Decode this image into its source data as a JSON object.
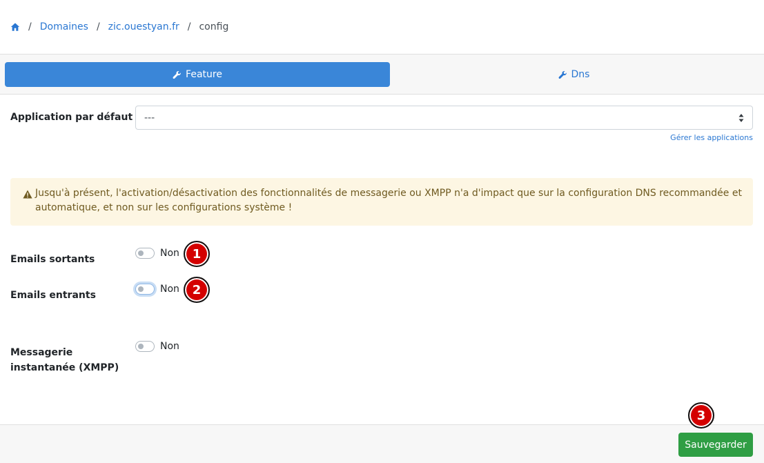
{
  "breadcrumb": {
    "home_icon": "home-icon",
    "items": [
      "Domaines",
      "zic.ouestyan.fr",
      "config"
    ]
  },
  "tabs": {
    "feature_label": "Feature",
    "dns_label": "Dns",
    "icon": "wrench-icon"
  },
  "default_app": {
    "label": "Application par défaut",
    "value": "---",
    "manage_link": "Gérer les applications"
  },
  "alert": {
    "icon": "warning-icon",
    "text": "Jusqu'à présent, l'activation/désactivation des fonctionnalités de messagerie ou XMPP n'a d'impact que sur la configuration DNS recommandée et automatique, et non sur les configurations système !"
  },
  "settings": [
    {
      "label": "Emails sortants",
      "state": "Non"
    },
    {
      "label": "Emails entrants",
      "state": "Non"
    },
    {
      "label": "Messagerie instantanée (XMPP)",
      "state": "Non"
    }
  ],
  "markers": [
    "1",
    "2",
    "3"
  ],
  "footer": {
    "save_label": "Sauvegarder"
  },
  "colors": {
    "accent": "#3a86d8",
    "link": "#2a77d2",
    "save": "#2f9e44",
    "marker": "#d40000",
    "alert_bg": "#fdf6e3"
  }
}
